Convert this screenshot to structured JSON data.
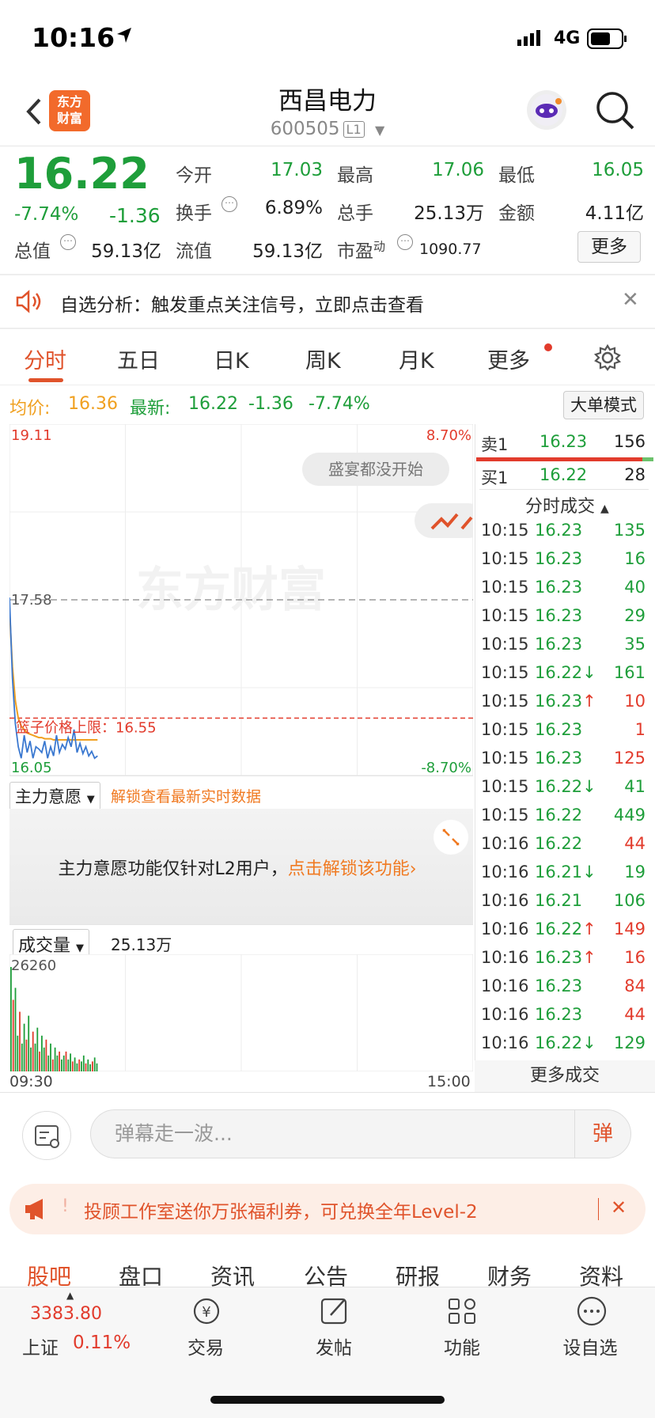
{
  "status_bar": {
    "time": "10:16",
    "network": "4G"
  },
  "header": {
    "logo_text": "东方财富",
    "stock_name": "西昌电力",
    "stock_code": "600505",
    "level_badge": "L1"
  },
  "quote": {
    "price": "16.22",
    "change_pct": "-7.74%",
    "change": "-1.36",
    "open_label": "今开",
    "open": "17.03",
    "high_label": "最高",
    "high": "17.06",
    "low_label": "最低",
    "low": "16.05",
    "turnover_label": "换手",
    "turnover": "6.89%",
    "volume_label": "总手",
    "volume": "25.13万",
    "amount_label": "金额",
    "amount": "4.11亿",
    "mktcap_label": "总值",
    "mktcap": "59.13亿",
    "float_label": "流值",
    "float_cap": "59.13亿",
    "pe_label": "市盈",
    "pe_sup": "动",
    "pe": "1090.77",
    "more_label": "更多"
  },
  "notice": {
    "text": "自选分析：触发重点关注信号，立即点击查看"
  },
  "tabs": [
    "分时",
    "五日",
    "日K",
    "周K",
    "月K",
    "更多"
  ],
  "chart_info": {
    "avg_label": "均价:",
    "avg": "16.36",
    "latest_label": "最新:",
    "latest": "16.22",
    "latest_chg": "-1.36",
    "latest_pct": "-7.74%",
    "mode_button": "大单模式",
    "bubble": "盛宴都没开始"
  },
  "chart_data": {
    "type": "line",
    "title": "",
    "y_top_label": "19.11",
    "y_mid_label": "17.58",
    "y_bottom_label": "16.05",
    "pct_top_label": "8.70%",
    "pct_bottom_label": "-8.70%",
    "ylim": [
      16.05,
      19.11
    ],
    "limit_label": "篮子价格上限：",
    "limit_value": 16.55,
    "limit_value_text": "16.55",
    "x_start_label": "09:30",
    "x_end_label": "15:00",
    "watermark": "东方财富",
    "series": [
      {
        "values": [
          17.6,
          16.9,
          16.5,
          16.3,
          16.2,
          16.4,
          16.25,
          16.35,
          16.2,
          16.3,
          16.28,
          16.25,
          16.35,
          16.2,
          16.3,
          16.22,
          16.4,
          16.25,
          16.32,
          16.28,
          16.38,
          16.3,
          16.45,
          16.25,
          16.33,
          16.24,
          16.3,
          16.22,
          16.26,
          16.2,
          16.22
        ]
      },
      {
        "values": [
          17.5,
          17.0,
          16.7,
          16.55,
          16.48,
          16.45,
          16.42,
          16.41,
          16.4,
          16.39,
          16.38,
          16.38,
          16.37,
          16.37,
          16.37,
          16.36,
          16.36,
          16.36,
          16.36,
          16.36,
          16.36,
          16.36,
          16.36,
          16.36,
          16.36,
          16.36,
          16.36,
          16.36,
          16.36,
          16.36,
          16.36
        ]
      }
    ],
    "volume_max_label": "26260",
    "volume_total_label": "成交量",
    "volume_total": "25.13万",
    "volume_values": [
      26260,
      18000,
      21000,
      9000,
      15000,
      7000,
      12000,
      8000,
      14000,
      6000,
      10000,
      7000,
      11000,
      5000,
      9000,
      6000,
      8000,
      4000,
      7000,
      3000,
      6000,
      4000,
      5000,
      3000,
      4000,
      5000,
      3000,
      4500,
      2500,
      3500,
      2000,
      3000,
      2500,
      4000,
      2000,
      3000,
      1800,
      2500,
      3500,
      2000
    ]
  },
  "main_force": {
    "label": "主力意愿",
    "unlock_hint": "解锁查看最新实时数据",
    "panel_text": "主力意愿功能仅针对L2用户，",
    "panel_link": "点击解锁该功能"
  },
  "order_book": {
    "sell1_label": "卖1",
    "sell1_price": "16.23",
    "sell1_vol": "156",
    "buy1_label": "买1",
    "buy1_price": "16.22",
    "buy1_vol": "28",
    "ticks_title": "分时成交",
    "ticks": [
      {
        "time": "10:15",
        "price": "16.23",
        "dir": "",
        "vol": "135",
        "color": "green"
      },
      {
        "time": "10:15",
        "price": "16.23",
        "dir": "",
        "vol": "16",
        "color": "green"
      },
      {
        "time": "10:15",
        "price": "16.23",
        "dir": "",
        "vol": "40",
        "color": "green"
      },
      {
        "time": "10:15",
        "price": "16.23",
        "dir": "",
        "vol": "29",
        "color": "green"
      },
      {
        "time": "10:15",
        "price": "16.23",
        "dir": "",
        "vol": "35",
        "color": "green"
      },
      {
        "time": "10:15",
        "price": "16.22",
        "dir": "↓",
        "vol": "161",
        "color": "green"
      },
      {
        "time": "10:15",
        "price": "16.23",
        "dir": "↑",
        "vol": "10",
        "color": "red"
      },
      {
        "time": "10:15",
        "price": "16.23",
        "dir": "",
        "vol": "1",
        "color": "red"
      },
      {
        "time": "10:15",
        "price": "16.23",
        "dir": "",
        "vol": "125",
        "color": "red"
      },
      {
        "time": "10:15",
        "price": "16.22",
        "dir": "↓",
        "vol": "41",
        "color": "green"
      },
      {
        "time": "10:15",
        "price": "16.22",
        "dir": "",
        "vol": "449",
        "color": "green"
      },
      {
        "time": "10:16",
        "price": "16.22",
        "dir": "",
        "vol": "44",
        "color": "red"
      },
      {
        "time": "10:16",
        "price": "16.21",
        "dir": "↓",
        "vol": "19",
        "color": "green"
      },
      {
        "time": "10:16",
        "price": "16.21",
        "dir": "",
        "vol": "106",
        "color": "green"
      },
      {
        "time": "10:16",
        "price": "16.22",
        "dir": "↑",
        "vol": "149",
        "color": "red"
      },
      {
        "time": "10:16",
        "price": "16.23",
        "dir": "↑",
        "vol": "16",
        "color": "red"
      },
      {
        "time": "10:16",
        "price": "16.23",
        "dir": "",
        "vol": "84",
        "color": "red"
      },
      {
        "time": "10:16",
        "price": "16.23",
        "dir": "",
        "vol": "44",
        "color": "red"
      },
      {
        "time": "10:16",
        "price": "16.22",
        "dir": "↓",
        "vol": "129",
        "color": "green"
      }
    ],
    "more_ticks": "更多成交"
  },
  "danmu": {
    "placeholder": "弹幕走一波...",
    "send": "弹"
  },
  "promo": {
    "text": "投顾工作室送你万张福利券，可兑换全年Level-2"
  },
  "bottom_tabs": [
    "股吧",
    "盘口",
    "资讯",
    "公告",
    "研报",
    "财务",
    "资料"
  ],
  "bottom_nav": {
    "index_value": "3383.80",
    "index_name": "上证",
    "index_pct": "0.11%",
    "items": [
      "交易",
      "发帖",
      "功能",
      "设自选"
    ]
  },
  "colors": {
    "up": "#e23b2c",
    "down": "#1e9e3a",
    "accent": "#e0532b",
    "avg_line": "#f0a020",
    "price_line": "#3a78d0"
  }
}
